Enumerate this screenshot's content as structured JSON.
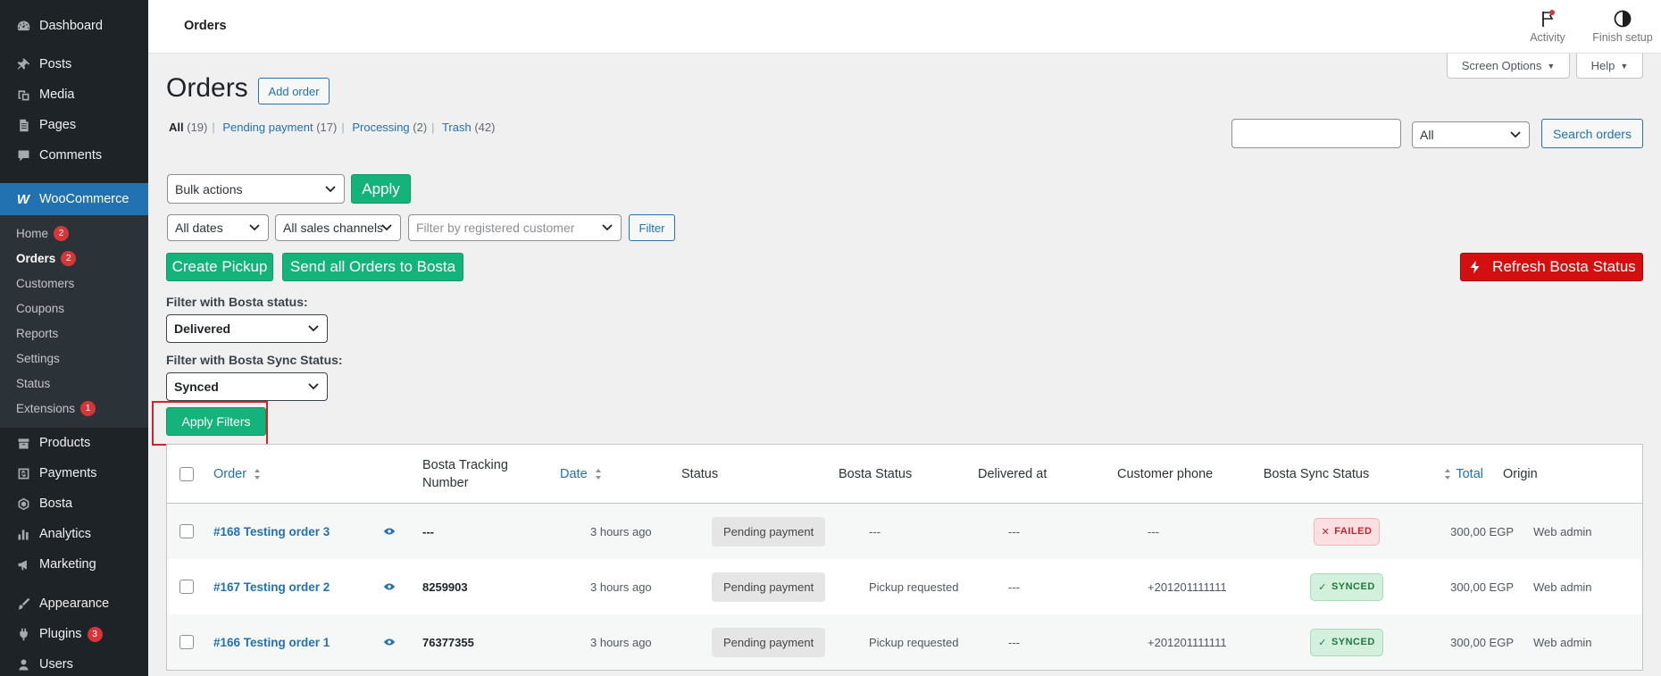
{
  "sidebar": {
    "items": [
      {
        "label": "Dashboard",
        "icon": "dashboard-icon"
      },
      {
        "label": "Posts",
        "icon": "pin-icon"
      },
      {
        "label": "Media",
        "icon": "media-icon"
      },
      {
        "label": "Pages",
        "icon": "pages-icon"
      },
      {
        "label": "Comments",
        "icon": "comment-icon"
      }
    ],
    "woocommerce": {
      "label": "WooCommerce",
      "icon": "woocommerce-icon"
    },
    "woo_sub": [
      {
        "label": "Home",
        "badge": "2"
      },
      {
        "label": "Orders",
        "badge": "2"
      },
      {
        "label": "Customers"
      },
      {
        "label": "Coupons"
      },
      {
        "label": "Reports"
      },
      {
        "label": "Settings"
      },
      {
        "label": "Status"
      },
      {
        "label": "Extensions",
        "badge": "1"
      }
    ],
    "lower_items": [
      {
        "label": "Products"
      },
      {
        "label": "Payments"
      },
      {
        "label": "Bosta"
      },
      {
        "label": "Analytics"
      },
      {
        "label": "Marketing"
      },
      {
        "label": "Appearance"
      },
      {
        "label": "Plugins",
        "badge": "3"
      },
      {
        "label": "Users"
      }
    ]
  },
  "header": {
    "title": "Orders",
    "activity_label": "Activity",
    "finish_setup_label": "Finish setup"
  },
  "screen_options_label": "Screen Options",
  "help_label": "Help",
  "page": {
    "title": "Orders",
    "add_order_label": "Add order"
  },
  "views": {
    "all_label": "All",
    "all_count": "(19)",
    "pending_label": "Pending payment",
    "pending_count": "(17)",
    "processing_label": "Processing",
    "processing_count": "(2)",
    "trash_label": "Trash",
    "trash_count": "(42)"
  },
  "search": {
    "value": "",
    "type_select": "All",
    "button_label": "Search orders"
  },
  "bulk": {
    "select_value": "Bulk actions",
    "apply_label": "Apply"
  },
  "filters": {
    "dates": "All dates",
    "channels": "All sales channels",
    "customer_placeholder": "Filter by registered customer",
    "filter_button": "Filter"
  },
  "bosta": {
    "create_pickup": "Create Pickup",
    "send_all": "Send all Orders to Bosta",
    "refresh_status": "Refresh Bosta Status",
    "status_label": "Filter with Bosta status:",
    "status_value": "Delivered",
    "sync_label": "Filter with Bosta Sync Status:",
    "sync_value": "Synced",
    "apply_filters": "Apply Filters"
  },
  "table": {
    "columns": {
      "order": "Order",
      "tracking": "Bosta Tracking Number",
      "date": "Date",
      "status": "Status",
      "bosta_status": "Bosta Status",
      "delivered_at": "Delivered at",
      "phone": "Customer phone",
      "sync": "Bosta Sync Status",
      "total": "Total",
      "origin": "Origin"
    },
    "rows": [
      {
        "order": "#168 Testing order 3",
        "tracking": "---",
        "date": "3 hours ago",
        "status": "Pending payment",
        "bosta_status": "---",
        "delivered_at": "---",
        "phone": "---",
        "sync": "FAILED",
        "sync_glyph": "✕",
        "total": "300,00 EGP",
        "origin": "Web admin"
      },
      {
        "order": "#167 Testing order 2",
        "tracking": "8259903",
        "date": "3 hours ago",
        "status": "Pending payment",
        "bosta_status": "Pickup requested",
        "delivered_at": "---",
        "phone": "+201201111111",
        "sync": "SYNCED",
        "sync_glyph": "✓",
        "total": "300,00 EGP",
        "origin": "Web admin"
      },
      {
        "order": "#166 Testing order 1",
        "tracking": "76377355",
        "date": "3 hours ago",
        "status": "Pending payment",
        "bosta_status": "Pickup requested",
        "delivered_at": "---",
        "phone": "+201201111111",
        "sync": "SYNCED",
        "sync_glyph": "✓",
        "total": "300,00 EGP",
        "origin": "Web admin"
      }
    ]
  },
  "colors": {
    "wp_blue": "#2271b1",
    "bosta_green": "#15b37c",
    "bosta_red": "#d40f0f",
    "sidebar_bg": "#1d2327"
  }
}
